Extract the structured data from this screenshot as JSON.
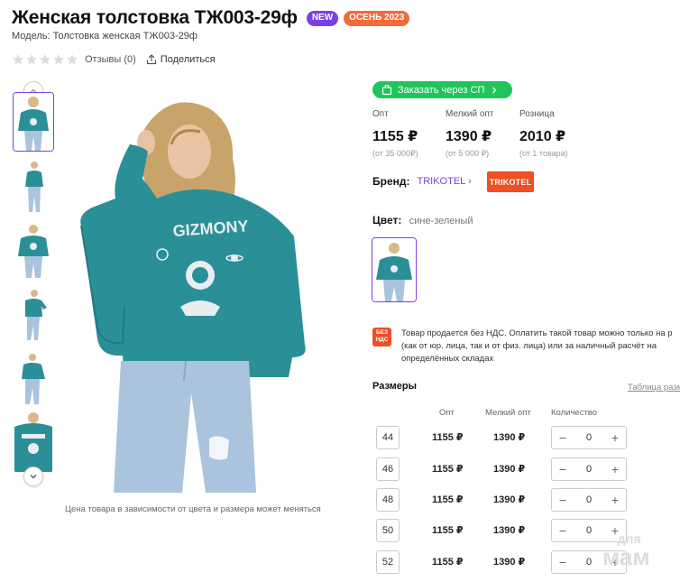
{
  "product": {
    "title": "Женская толстовка ТЖ003-29ф",
    "badges": {
      "new": "NEW",
      "season": "ОСЕНЬ 2023"
    },
    "model": "Модель: Толстовка женская ТЖ003-29ф",
    "reviews": "Отзывы (0)",
    "share": "Поделиться",
    "rating": 0
  },
  "gallery": {
    "caption": "Цена товара в зависимости от цвета и размера может меняться",
    "thumb_count": 6
  },
  "order": {
    "label": "Заказать через СП"
  },
  "prices": [
    {
      "label": "Опт",
      "value": "1155 ₽",
      "sub": "(от 35 000₽)"
    },
    {
      "label": "Мелкий опт",
      "value": "1390 ₽",
      "sub": "(от 5 000 ₽)"
    },
    {
      "label": "Розница",
      "value": "2010 ₽",
      "sub": "(от 1 товара)"
    }
  ],
  "brand": {
    "label": "Бренд:",
    "name": "TRIKOTEL",
    "logo": "TRIKOTEL"
  },
  "color": {
    "label": "Цвет:",
    "value": "сине-зеленый"
  },
  "vat": {
    "icon": "БЕЗ НДС",
    "lines": [
      "Товар продается без НДС. Оплатить такой товар можно только на р",
      "(как от юр. лица, так и от физ. лица) или за наличный расчёт на",
      "определённых складах"
    ]
  },
  "sizes": {
    "title": "Размеры",
    "table_link": "Таблица разм",
    "headers": {
      "opt": "Опт",
      "small_opt": "Мелкий опт",
      "qty": "Количество"
    },
    "rows": [
      {
        "size": "44",
        "opt": "1155 ₽",
        "small_opt": "1390 ₽",
        "qty": "0"
      },
      {
        "size": "46",
        "opt": "1155 ₽",
        "small_opt": "1390 ₽",
        "qty": "0"
      },
      {
        "size": "48",
        "opt": "1155 ₽",
        "small_opt": "1390 ₽",
        "qty": "0"
      },
      {
        "size": "50",
        "opt": "1155 ₽",
        "small_opt": "1390 ₽",
        "qty": "0"
      },
      {
        "size": "52",
        "opt": "1155 ₽",
        "small_opt": "1390 ₽",
        "qty": "0"
      }
    ]
  },
  "watermark": {
    "small": "для",
    "big": "мам"
  },
  "colors": {
    "accent": "#7b3fe4",
    "green": "#1fc55a",
    "orange": "#f26b3a",
    "brand_red": "#f04e23",
    "sweater": "#2b8f98",
    "jeans": "#a9c4dc"
  },
  "icons": {
    "share": "share-icon",
    "cart": "cart-icon",
    "star": "star-icon",
    "up": "chevron-up-icon",
    "down": "chevron-down-icon"
  }
}
